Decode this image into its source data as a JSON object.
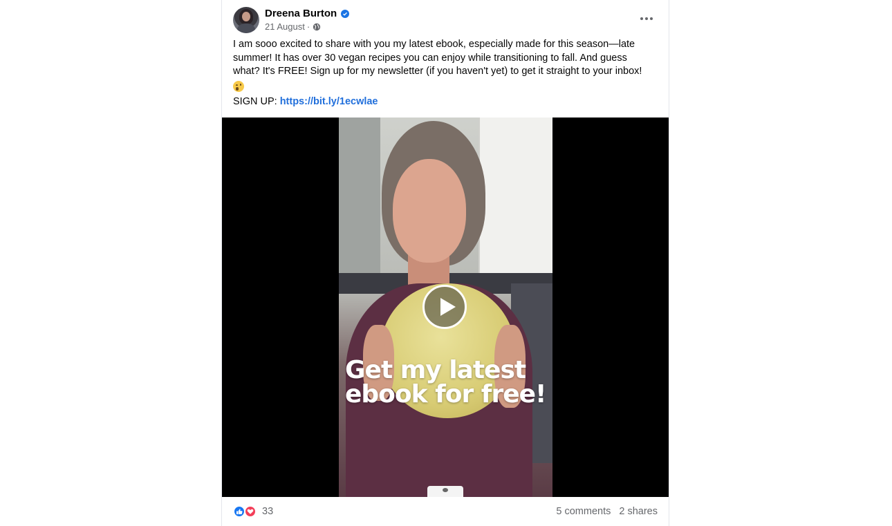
{
  "post": {
    "author": "Dreena Burton",
    "date": "21 August",
    "meta_separator": "·",
    "body_text": "I am sooo excited to share with you my latest ebook, especially made for this season—late summer! It has over 30 vegan recipes you can enjoy while transitioning to fall. And guess what? It's FREE! Sign up for my newsletter (if you haven't yet) to get it straight to your inbox! ",
    "signup_label": "SIGN UP: ",
    "signup_link": "https://bit.ly/1ecwlae"
  },
  "video": {
    "overlay_line1": "Get my latest",
    "overlay_line2": "ebook for free!"
  },
  "footer": {
    "reaction_count": "33",
    "comments": "5 comments",
    "shares": "2 shares"
  },
  "icons": {
    "verified": "verified-badge-icon",
    "audience": "globe-icon",
    "more": "more-options-icon",
    "play": "play-icon",
    "like": "like-reaction-icon",
    "love": "love-reaction-icon"
  },
  "colors": {
    "link": "#216fdb",
    "verified": "#1b74e4",
    "like": "#1877f2",
    "love": "#f33e58",
    "secondary_text": "#65676b"
  }
}
